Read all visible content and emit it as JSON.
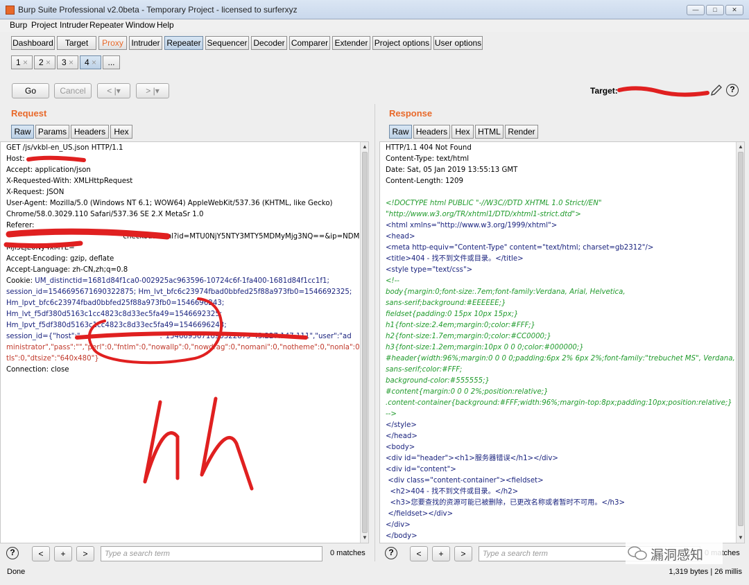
{
  "window": {
    "title": "Burp Suite Professional v2.0beta - Temporary Project - licensed to surferxyz",
    "min": "—",
    "max": "□",
    "close": "✕"
  },
  "menu": [
    "Burp",
    "Project",
    "Intruder",
    "Repeater",
    "Window",
    "Help"
  ],
  "main_tabs": [
    "Dashboard",
    "Target",
    "Proxy",
    "Intruder",
    "Repeater",
    "Sequencer",
    "Decoder",
    "Comparer",
    "Extender",
    "Project options",
    "User options"
  ],
  "sub_tabs": [
    {
      "label": "1",
      "close": "×"
    },
    {
      "label": "2",
      "close": "×"
    },
    {
      "label": "3",
      "close": "×"
    },
    {
      "label": "4",
      "close": "×"
    },
    {
      "label": "..."
    }
  ],
  "toolbar": {
    "go": "Go",
    "cancel": "Cancel",
    "back": "< |▾",
    "forward": "> |▾",
    "target_label": "Target:"
  },
  "request": {
    "title": "Request",
    "tabs": [
      "Raw",
      "Params",
      "Headers",
      "Hex"
    ],
    "lines": [
      "GET /js/vkbl-en_US.json HTTP/1.1",
      "Host:",
      "Accept: application/json",
      "X-Requested-With: XMLHttpRequest",
      "X-Request: JSON",
      "User-Agent: Mozilla/5.0 (Windows NT 6.1; WOW64) AppleWebKit/537.36 (KHTML, like Gecko)",
      "Chrome/58.0.3029.110 Safari/537.36 SE 2.X MetaSr 1.0",
      "Referer:",
      "                                                    checkout.html?id=MTU0NjY5NTY3MTY5MDMyMjg3NQ==&ip=NDMu",
      "MjI3LjE0Ny4xMTE=",
      "Accept-Encoding: gzip, deflate",
      "Accept-Language: zh-CN,zh;q=0.8"
    ],
    "cookie_label": "Cookie:",
    "cookie_lines": [
      "UM_distinctid=1681d84f1ca0-002925ac963596-10724c6f-1fa400-1681d84f1cc1f1;",
      "session_id=1546695671690322875; Hm_lvt_bfc6c23974fbad0bbfed25f88a973fb0=1546692325;",
      "Hm_lpvt_bfc6c23974fbad0bbfed25f88a973fb0=1546696243;",
      "Hm_lvt_f5df380d5163c1cc4823c8d33ec5fa49=1546692325;",
      "Hm_lpvt_f5df380d5163c1cc4823c8d33ec5fa49=1546696243;",
      "session_id={\"host\":\"                                  \":\"1546695671690322875-43.227.147.111\",\"user\":\"ad",
      "ministrator\",\"pass\":\"\",\"perl\":0,\"fntlm\":0,\"nowallp\":0,\"nowdrag\":0,\"nomani\":0,\"notheme\":0,\"nonla\":0,\"no",
      "tls\":0,\"dtsize\":\"640x480\"}"
    ],
    "last_line": "Connection: close",
    "handwriting": "hh",
    "search_placeholder": "Type a search term",
    "matches": "0 matches"
  },
  "response": {
    "title": "Response",
    "tabs": [
      "Raw",
      "Headers",
      "Hex",
      "HTML",
      "Render"
    ],
    "header_lines": [
      "HTTP/1.1 404 Not Found",
      "Content-Type: text/html",
      "Date: Sat, 05 Jan 2019 13:55:13 GMT",
      "Content-Length: 1209"
    ],
    "body_lines": [
      [
        "<!DOCTYPE html PUBLIC \"-//W3C//DTD XHTML 1.0 Strict//EN\"",
        "green"
      ],
      [
        "\"http://www.w3.org/TR/xhtml1/DTD/xhtml1-strict.dtd\">",
        "green"
      ],
      [
        "<html xmlns=\"http://www.w3.org/1999/xhtml\">",
        "blue"
      ],
      [
        "<head>",
        "blue"
      ],
      [
        "<meta http-equiv=\"Content-Type\" content=\"text/html; charset=gb2312\"/>",
        "blue"
      ],
      [
        "<title>404 - 找不到文件或目录。</title>",
        "blue"
      ],
      [
        "<style type=\"text/css\">",
        "blue"
      ],
      [
        "<!--",
        "green"
      ],
      [
        "body{margin:0;font-size:.7em;font-family:Verdana, Arial, Helvetica,",
        "green"
      ],
      [
        "sans-serif;background:#EEEEEE;}",
        "green"
      ],
      [
        "fieldset{padding:0 15px 10px 15px;}",
        "green"
      ],
      [
        "h1{font-size:2.4em;margin:0;color:#FFF;}",
        "green"
      ],
      [
        "h2{font-size:1.7em;margin:0;color:#CC0000;}",
        "green"
      ],
      [
        "h3{font-size:1.2em;margin:10px 0 0 0;color:#000000;}",
        "green"
      ],
      [
        "#header{width:96%;margin:0 0 0 0;padding:6px 2% 6px 2%;font-family:\"trebuchet MS\", Verdana,",
        "green"
      ],
      [
        "sans-serif;color:#FFF;",
        "green"
      ],
      [
        "background-color:#555555;}",
        "green"
      ],
      [
        "#content{margin:0 0 0 2%;position:relative;}",
        "green"
      ],
      [
        ".content-container{background:#FFF;width:96%;margin-top:8px;padding:10px;position:relative;}",
        "green"
      ],
      [
        "-->",
        "green"
      ],
      [
        "</style>",
        "blue"
      ],
      [
        "</head>",
        "blue"
      ],
      [
        "<body>",
        "blue"
      ],
      [
        "<div id=\"header\"><h1>服务器错误</h1></div>",
        "blue"
      ],
      [
        "<div id=\"content\">",
        "blue"
      ],
      [
        " <div class=\"content-container\"><fieldset>",
        "blue"
      ],
      [
        "  <h2>404 - 找不到文件或目录。</h2>",
        "blue"
      ],
      [
        "  <h3>您要查找的资源可能已被删除，已更改名称或者暂时不可用。</h3>",
        "blue"
      ],
      [
        " </fieldset></div>",
        "blue"
      ],
      [
        "</div>",
        "blue"
      ],
      [
        "</body>",
        "blue"
      ]
    ],
    "search_placeholder": "Type a search term",
    "matches": "0 matches"
  },
  "nav": {
    "prev": "<",
    "add": "+",
    "next": ">",
    "help": "?"
  },
  "watermark": "漏洞感知",
  "status": {
    "left": "Done",
    "right": "1,319 bytes | 26 millis"
  },
  "colors": {
    "accent": "#e8692a",
    "redact": "#e02020"
  }
}
